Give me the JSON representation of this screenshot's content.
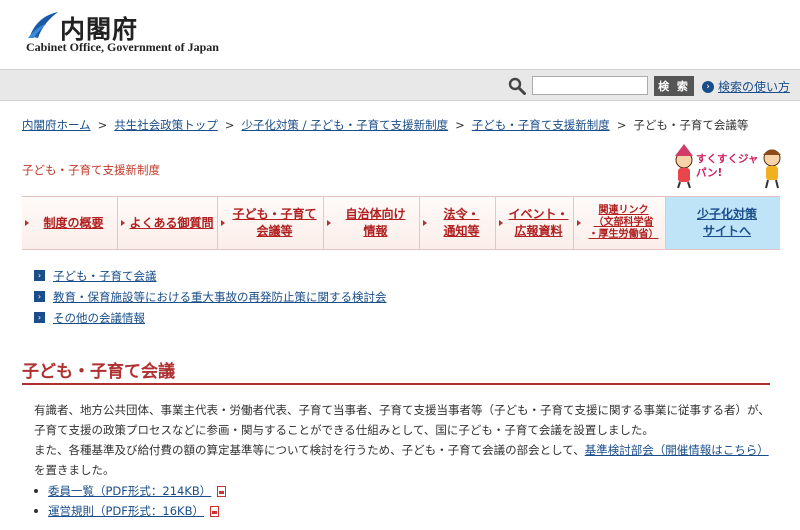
{
  "header": {
    "logo_jp": "内閣府",
    "logo_en": "Cabinet Office, Government of Japan"
  },
  "search": {
    "value": "",
    "placeholder": "",
    "button_label": "検 索",
    "help_label": "検索の使い方"
  },
  "breadcrumb": [
    "内閣府ホーム",
    "共生社会政策トップ",
    "少子化対策 / 子ども・子育て支援新制度",
    "子ども・子育て支援新制度",
    "子ども・子育て会議等"
  ],
  "section_title": "子ども・子育て支援新制度",
  "mascot_text": "すくすくジャパン!",
  "nav": [
    {
      "label": "制度の概要"
    },
    {
      "label": "よくある御質問"
    },
    {
      "label": "子ども・子育て\n会議等"
    },
    {
      "label": "自治体向け\n情報"
    },
    {
      "label": "法令・\n通知等"
    },
    {
      "label": "イベント・\n広報資料"
    },
    {
      "label": "関連リンク\n（文部科学省\n・厚生労働省）"
    },
    {
      "label": "少子化対策\nサイトへ"
    }
  ],
  "links": [
    "子ども・子育て会議",
    "教育・保育施設等における重大事故の再発防止策に関する検討会",
    "その他の会議情報"
  ],
  "heading": "子ども・子育て会議",
  "paragraph": {
    "line1": "有識者、地方公共団体、事業主代表・労働者代表、子育て当事者、子育て支援当事者等（子ども・子育て支援に関する事業に従事する者）が、子育て支援の政策プロセスなどに参画・関与することができる仕組みとして、国に子ども・子育て会議を設置しました。",
    "line2_before": "また、各種基準及び給付費の額の算定基準等について検討を行うため、子ども・子育て会議の部会として、",
    "line2_link": "基準検討部会（開催情報はこちら）",
    "line2_after": "を置きました。"
  },
  "documents": [
    "委員一覧（PDF形式：214KB）",
    "運営規則（PDF形式：16KB）"
  ],
  "colors": {
    "accent_red": "#b03030",
    "link_blue": "#1a4e8a",
    "nav_blue": "#bfe3f7"
  }
}
